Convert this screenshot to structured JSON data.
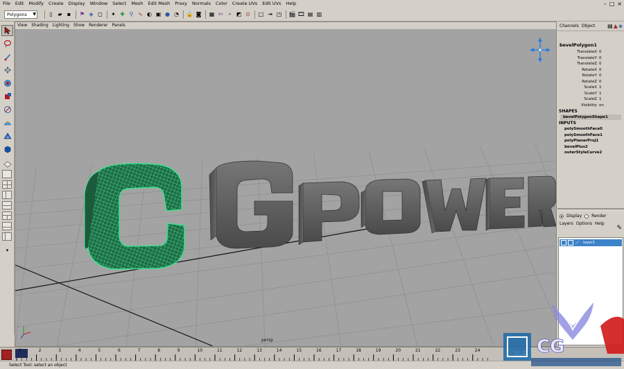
{
  "menubar": {
    "items": [
      "File",
      "Edit",
      "Modify",
      "Create",
      "Display",
      "Window",
      "Select",
      "Mesh",
      "Edit Mesh",
      "Proxy",
      "Normals",
      "Color",
      "Create UVs",
      "Edit UVs",
      "Help"
    ]
  },
  "statusline": {
    "mode_menu": "Polygons"
  },
  "viewport": {
    "menu": [
      "View",
      "Shading",
      "Lighting",
      "Show",
      "Renderer",
      "Panels"
    ],
    "camera_label": "persp",
    "scene_text_selected": "C",
    "scene_text": "GPOWER"
  },
  "channel_box": {
    "tabs": [
      "Channels",
      "Object"
    ],
    "object_name": "bevelPolygon1",
    "attributes": [
      {
        "name": "TranslateX",
        "value": "0"
      },
      {
        "name": "TranslateY",
        "value": "0"
      },
      {
        "name": "TranslateZ",
        "value": "0"
      },
      {
        "name": "RotateX",
        "value": "0"
      },
      {
        "name": "RotateY",
        "value": "0"
      },
      {
        "name": "RotateZ",
        "value": "0"
      },
      {
        "name": "ScaleX",
        "value": "1"
      },
      {
        "name": "ScaleY",
        "value": "1"
      },
      {
        "name": "ScaleZ",
        "value": "1"
      },
      {
        "name": "Visibility",
        "value": "on"
      }
    ],
    "shapes_heading": "SHAPES",
    "shape": "bevelPolygonShape1",
    "inputs_heading": "INPUTS",
    "inputs": [
      "polySmoothFace0",
      "polySmoothFace1",
      "polyPlanarProj1",
      "bevelPlus2",
      "outerStyleCurve2"
    ]
  },
  "layer_editor": {
    "display_label": "Display",
    "render_label": "Render",
    "menu": [
      "Layers",
      "Options",
      "Help"
    ],
    "layer_name": "layer1"
  },
  "time_slider": {
    "ticks": [
      "1",
      "2",
      "3",
      "4",
      "5",
      "6",
      "7",
      "8",
      "9",
      "10",
      "11",
      "12",
      "13",
      "14",
      "15",
      "16",
      "17",
      "18",
      "19",
      "20",
      "21",
      "22",
      "23",
      "24"
    ],
    "current_frame": "1.00"
  },
  "help_line": {
    "text": "Select Tool: select an object"
  },
  "watermark": {
    "text": "CG"
  },
  "colors": {
    "viewport_bg": "#a3a3a3",
    "selection_green": "#3fe08f",
    "layer_highlight": "#3d83c9",
    "ui_gray": "#d4d0c8"
  }
}
